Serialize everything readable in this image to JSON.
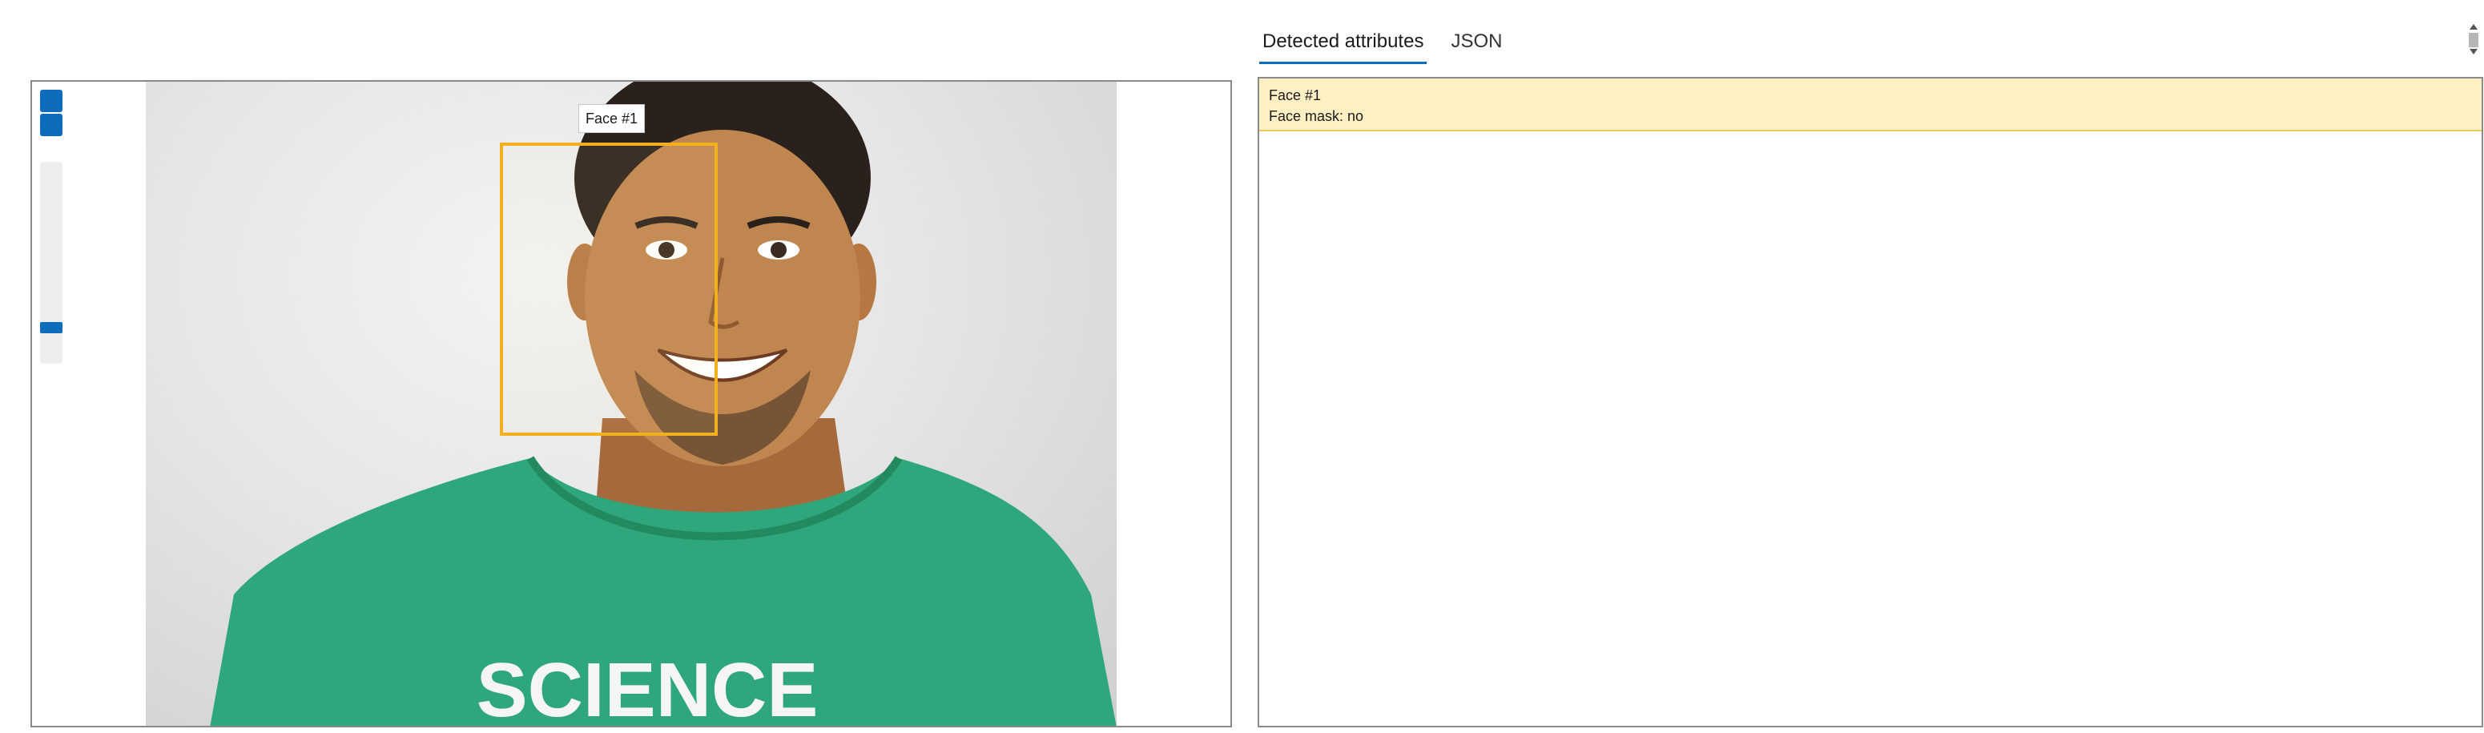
{
  "tabs": [
    {
      "label": "Detected attributes",
      "active": true
    },
    {
      "label": "JSON",
      "active": false
    }
  ],
  "viewer": {
    "face_tag": "Face #1",
    "shirt_text": "SCIENCE"
  },
  "results": [
    {
      "title": "Face #1",
      "attribute": "Face mask: no"
    }
  ],
  "colors": {
    "accent": "#0f6cbd",
    "face_box": "#f2b01e",
    "highlight": "#fff0c4",
    "shirt": "#2fa77c"
  },
  "icons": {
    "zoom_in": "zoom-in-icon",
    "zoom_out": "zoom-out-icon"
  }
}
